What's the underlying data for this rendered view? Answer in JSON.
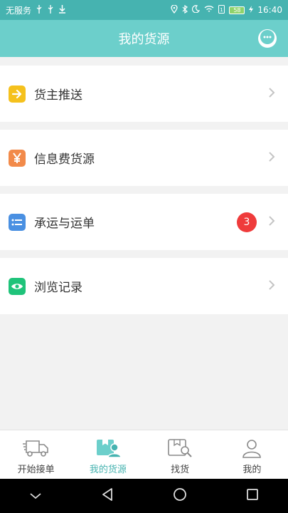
{
  "status_bar": {
    "carrier": "无服务",
    "battery": "58",
    "time": "16:40"
  },
  "header": {
    "title": "我的货源",
    "chat_icon": "chat-bubble-icon"
  },
  "menu": {
    "items": [
      {
        "label": "货主推送",
        "icon": "arrow-right-icon",
        "color": "#f5c11d"
      },
      {
        "label": "信息费货源",
        "icon": "yen-icon",
        "color": "#f28a4a"
      },
      {
        "label": "承运与运单",
        "icon": "list-icon",
        "color": "#4a90e2",
        "badge": "3"
      },
      {
        "label": "浏览记录",
        "icon": "eye-icon",
        "color": "#1fc37a"
      }
    ]
  },
  "bottom_nav": {
    "items": [
      {
        "label": "开始接单",
        "icon": "truck-icon"
      },
      {
        "label": "我的货源",
        "icon": "cargo-user-icon",
        "active": true
      },
      {
        "label": "找货",
        "icon": "cargo-search-icon"
      },
      {
        "label": "我的",
        "icon": "person-icon"
      }
    ]
  },
  "colors": {
    "accent": "#46b3b0",
    "header": "#6ccfcb",
    "badge": "#ef3b3b"
  }
}
